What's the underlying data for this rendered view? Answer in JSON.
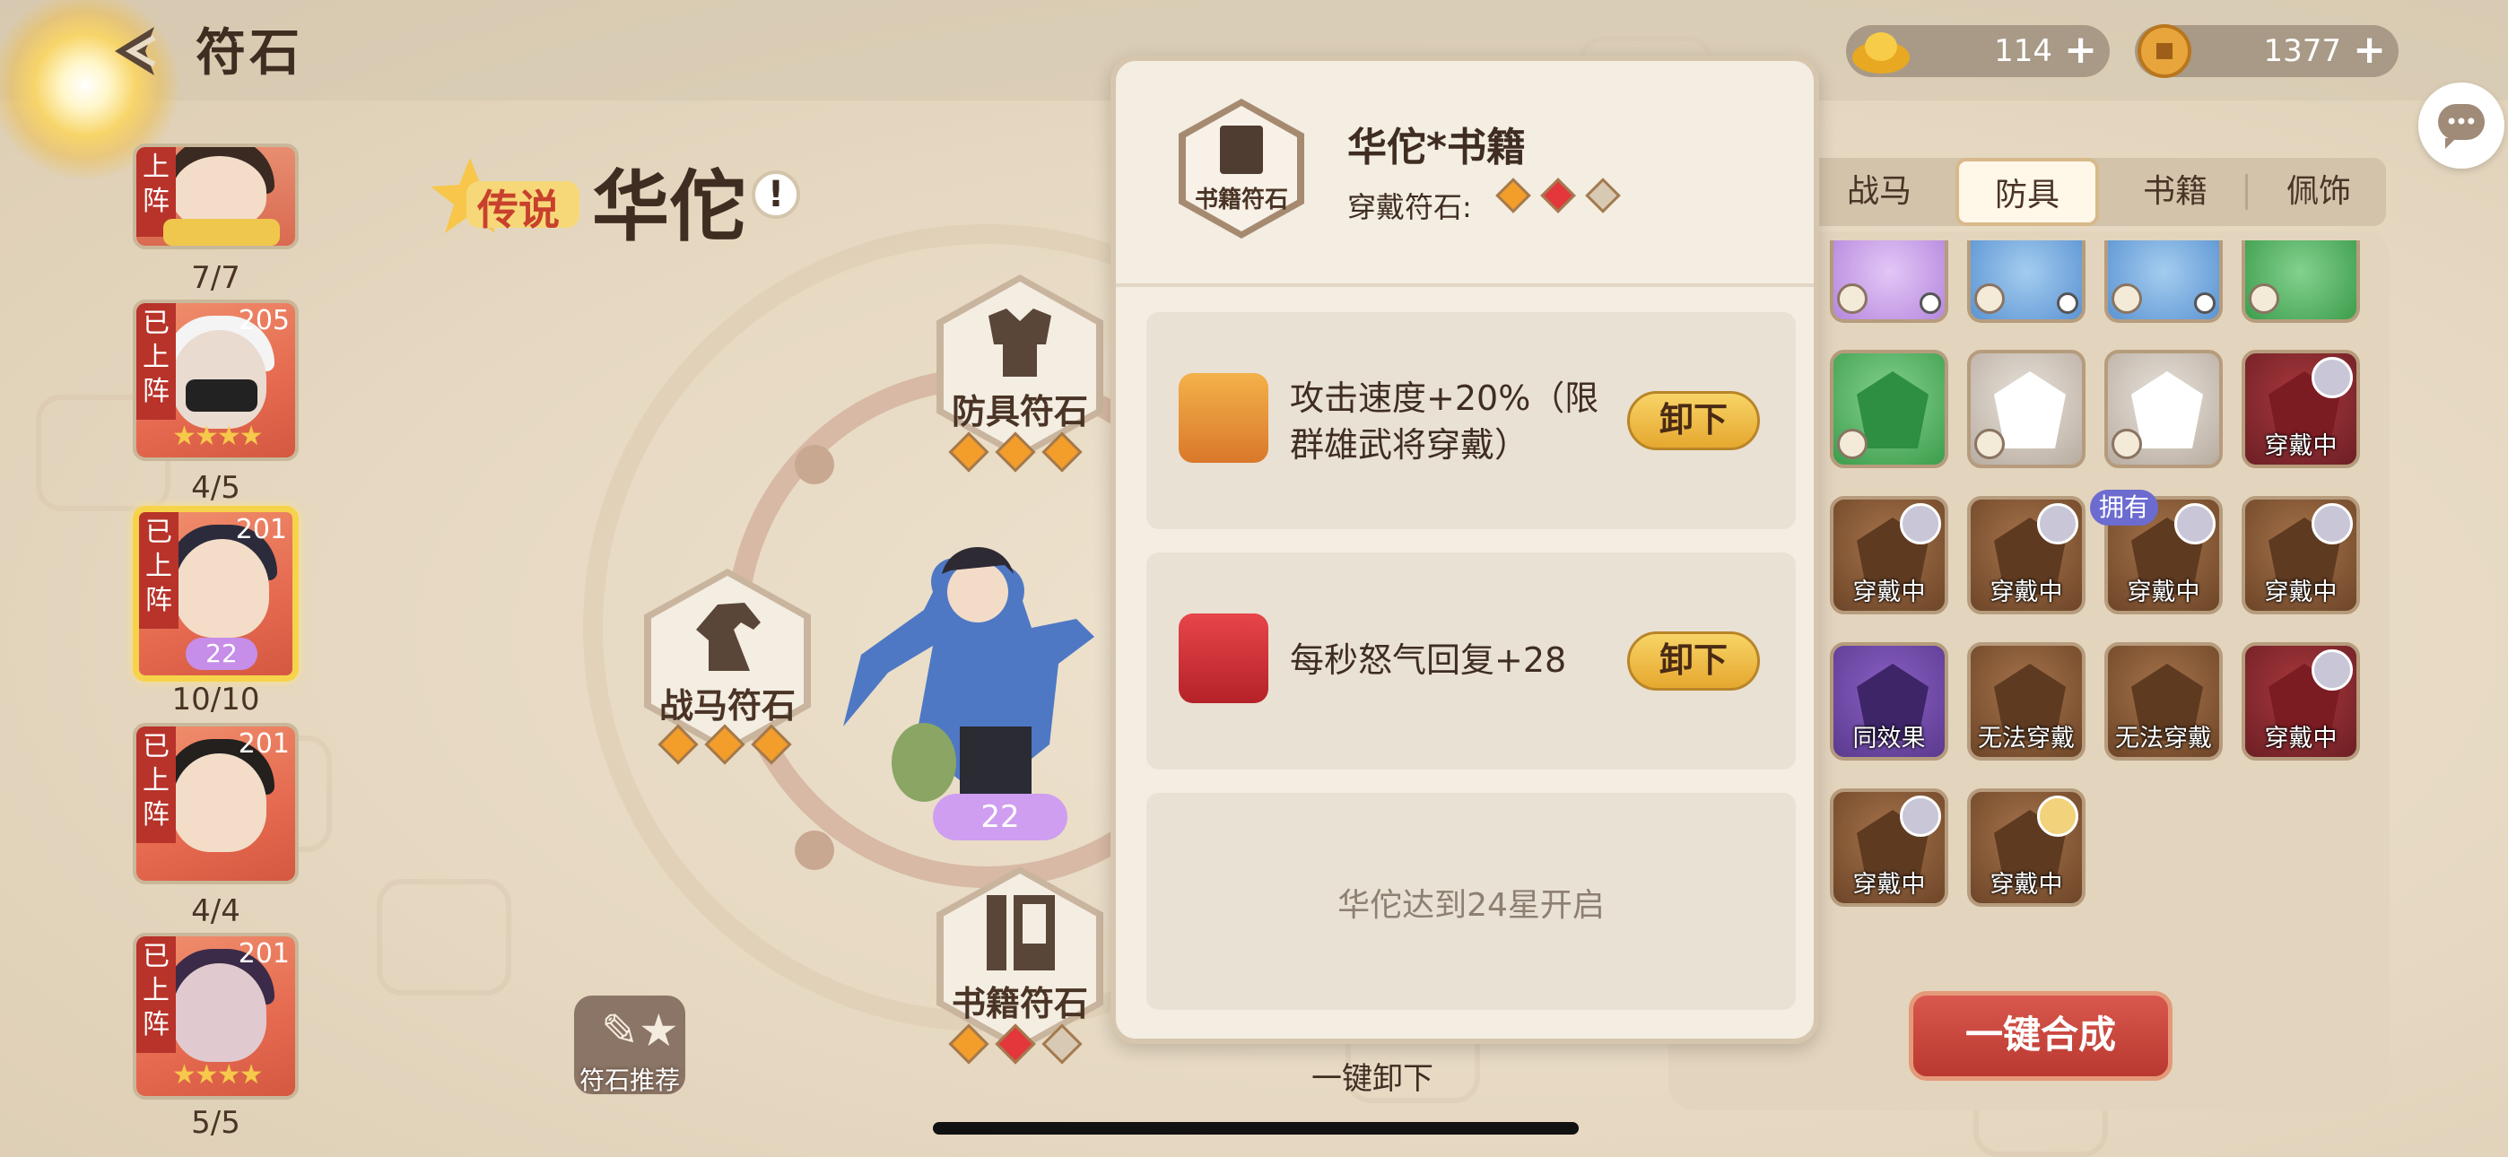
{
  "header": {
    "title": "符石",
    "back_icon": "back-arrow-icon"
  },
  "currency": [
    {
      "name": "gold-ingot",
      "value": "114",
      "plus": "+"
    },
    {
      "name": "coin",
      "value": "1377",
      "plus": "+"
    }
  ],
  "heroes": [
    {
      "tag": "上阵",
      "level": "",
      "count": "7/7"
    },
    {
      "tag": "已上阵",
      "level": "205",
      "count": "4/5",
      "stars": "★★★★"
    },
    {
      "tag": "已上阵",
      "level": "201",
      "count": "10/10",
      "starnum": "22",
      "selected": true
    },
    {
      "tag": "已上阵",
      "level": "201",
      "count": "4/4"
    },
    {
      "tag": "已上阵",
      "level": "201",
      "count": "5/5",
      "stars": "★★★★"
    }
  ],
  "hero_detail": {
    "rarity": "传说",
    "name": "华佗",
    "info": "!",
    "star_level": "22"
  },
  "rune_slots": {
    "armor": {
      "label": "防具符石"
    },
    "horse": {
      "label": "战马符石"
    },
    "book": {
      "label": "书籍符石"
    }
  },
  "recommend": {
    "label": "符石推荐"
  },
  "unequip_all": "一键卸下",
  "popup": {
    "icon_label": "书籍符石",
    "title": "华佗*书籍",
    "equipped_label": "穿戴符石:",
    "empty_gem": "一",
    "rows": [
      {
        "text": "攻击速度+20%（限群雄武将穿戴）",
        "button": "卸下"
      },
      {
        "text": "每秒怒气回复+28",
        "button": "卸下"
      },
      {
        "locked_text": "华佗达到24星开启"
      }
    ]
  },
  "tabs": [
    "战马",
    "防具",
    "书籍",
    "佩饰"
  ],
  "active_tab": "防具",
  "inventory": {
    "captions": [
      "穿戴中",
      "穿戴中",
      "穿戴中",
      "穿戴中",
      "穿戴中",
      "同效果",
      "无法穿戴",
      "无法穿戴",
      "穿戴中",
      "穿戴中",
      "穿戴中"
    ],
    "owned_tag": "拥有"
  },
  "combine_button": "一键合成"
}
